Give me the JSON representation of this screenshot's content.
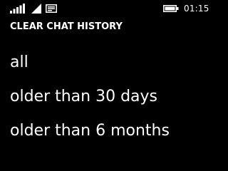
{
  "status_bar": {
    "icons": [
      "signal-icon",
      "wifi-icon",
      "message-icon",
      "battery-icon"
    ],
    "time": "01:15"
  },
  "page": {
    "title": "CLEAR CHAT HISTORY"
  },
  "options": [
    {
      "label": "all"
    },
    {
      "label": "older than 30 days"
    },
    {
      "label": "older than 6 months"
    }
  ],
  "colors": {
    "background": "#000000",
    "text": "#ffffff"
  }
}
